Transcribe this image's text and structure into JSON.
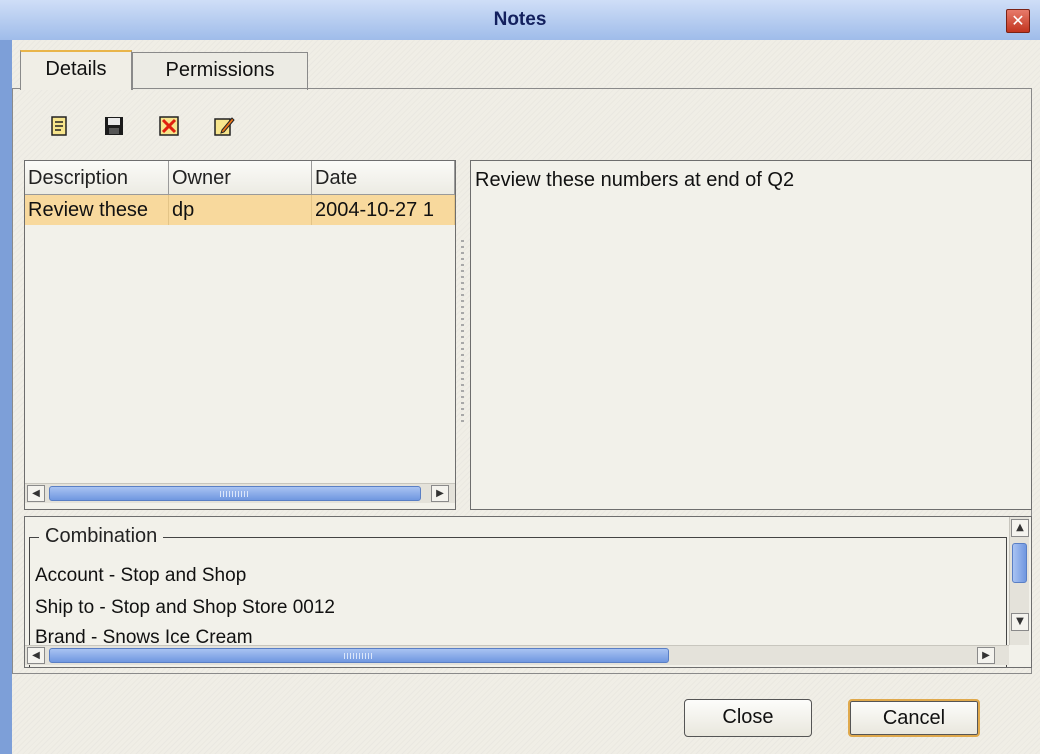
{
  "window": {
    "title": "Notes"
  },
  "tabs": [
    {
      "label": "Details",
      "active": true
    },
    {
      "label": "Permissions",
      "active": false
    }
  ],
  "toolbar": {
    "icons": [
      "new-note-icon",
      "save-icon",
      "delete-icon",
      "edit-icon"
    ]
  },
  "notes_table": {
    "columns": [
      "Description",
      "Owner",
      "Date"
    ],
    "rows": [
      {
        "description": "Review these",
        "owner": "dp",
        "date": "2004-10-27 1"
      }
    ]
  },
  "note_detail": {
    "text": "Review these numbers at end of Q2"
  },
  "combination": {
    "legend": "Combination",
    "lines": [
      "Account - Stop and Shop",
      "Ship to - Stop and Shop Store 0012",
      "Brand - Snows Ice Cream"
    ]
  },
  "buttons": {
    "close": "Close",
    "cancel": "Cancel"
  },
  "colors": {
    "title_bar": "#9fbcea",
    "selected_row": "#f8d99d",
    "active_tab_accent": "#e9b54a",
    "scroll_thumb": "#7097e0",
    "close_x": "#c2341f"
  }
}
